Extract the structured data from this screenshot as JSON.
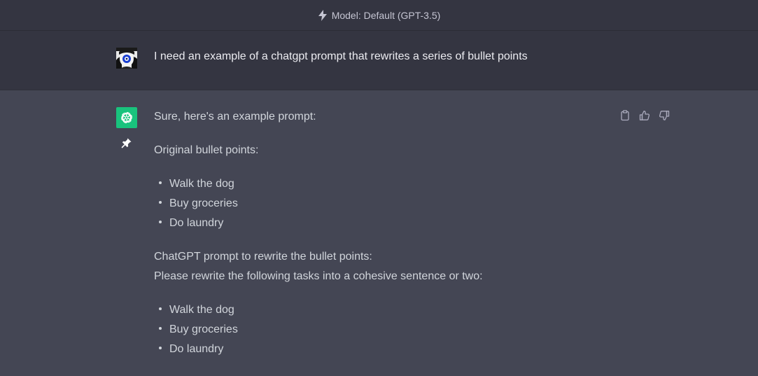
{
  "topbar": {
    "model_label": "Model: Default (GPT-3.5)"
  },
  "user_message": {
    "text": "I need an example of a chatgpt prompt that rewrites a series of bullet points"
  },
  "assistant_message": {
    "intro": "Sure, here's an example prompt:",
    "original_heading": "Original bullet points:",
    "original_items": [
      "Walk the dog",
      "Buy groceries",
      "Do laundry"
    ],
    "prompt_heading": "ChatGPT prompt to rewrite the bullet points:",
    "prompt_instruction": "Please rewrite the following tasks into a cohesive sentence or two:",
    "prompt_items": [
      "Walk the dog",
      "Buy groceries",
      "Do laundry"
    ]
  },
  "icons": {
    "model": "bolt-icon",
    "copy": "clipboard-icon",
    "like": "thumbs-up-icon",
    "dislike": "thumbs-down-icon",
    "pin": "pin-icon",
    "assistant_avatar": "openai-logo-icon"
  },
  "colors": {
    "background": "#444654",
    "user_background": "#343541",
    "brand": "#19c37d"
  }
}
